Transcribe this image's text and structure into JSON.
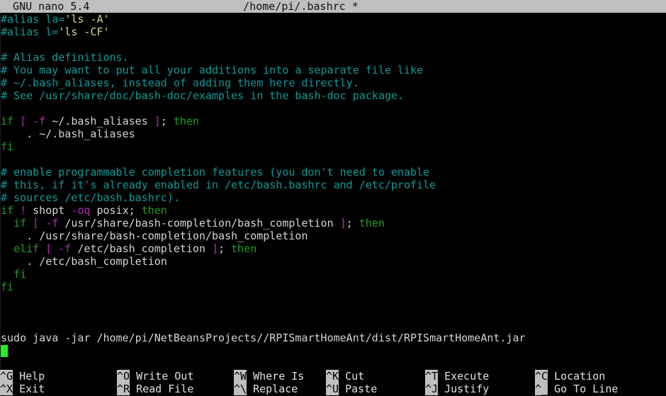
{
  "titlebar": {
    "app_name": "GNU nano 5.4",
    "filename": "/home/pi/.bashrc *",
    "bg_color": "#bfbfbf",
    "fg_color": "#101010"
  },
  "editor": {
    "background_color": "#000000",
    "colors": {
      "comment": "#0f9a9a",
      "string": "#d7d77a",
      "keyword": "#19a319",
      "operator": "#b429b4",
      "plain": "#d4d4d4",
      "cursor": "#22ee22"
    },
    "lines": [
      {
        "i": 0,
        "text": "#alias la='ls -A'"
      },
      {
        "i": 1,
        "text": "#alias l='ls -CF'"
      },
      {
        "i": 2,
        "text": ""
      },
      {
        "i": 3,
        "text": "# Alias definitions."
      },
      {
        "i": 4,
        "text": "# You may want to put all your additions into a separate file like"
      },
      {
        "i": 5,
        "text": "# ~/.bash_aliases, instead of adding them here directly."
      },
      {
        "i": 6,
        "text": "# See /usr/share/doc/bash-doc/examples in the bash-doc package."
      },
      {
        "i": 7,
        "text": ""
      },
      {
        "i": 8,
        "text": "if [ -f ~/.bash_aliases ]; then"
      },
      {
        "i": 9,
        "text": "    . ~/.bash_aliases"
      },
      {
        "i": 10,
        "text": "fi"
      },
      {
        "i": 11,
        "text": ""
      },
      {
        "i": 12,
        "text": "# enable programmable completion features (you don't need to enable"
      },
      {
        "i": 13,
        "text": "# this, if it's already enabled in /etc/bash.bashrc and /etc/profile"
      },
      {
        "i": 14,
        "text": "# sources /etc/bash.bashrc)."
      },
      {
        "i": 15,
        "text": "if ! shopt -oq posix; then"
      },
      {
        "i": 16,
        "text": "  if [ -f /usr/share/bash-completion/bash_completion ]; then"
      },
      {
        "i": 17,
        "text": "    . /usr/share/bash-completion/bash_completion"
      },
      {
        "i": 18,
        "text": "  elif [ -f /etc/bash_completion ]; then"
      },
      {
        "i": 19,
        "text": "    . /etc/bash_completion"
      },
      {
        "i": 20,
        "text": "  fi"
      },
      {
        "i": 21,
        "text": "fi"
      },
      {
        "i": 22,
        "text": ""
      },
      {
        "i": 23,
        "text": ""
      },
      {
        "i": 24,
        "text": ""
      },
      {
        "i": 25,
        "text": "sudo java -jar /home/pi/NetBeansProjects//RPISmartHomeAnt/dist/RPISmartHomeAnt.jar"
      },
      {
        "i": 26,
        "text": ""
      }
    ],
    "cursor": {
      "line": 26,
      "column": 0
    }
  },
  "shortcuts": {
    "row1": [
      {
        "key": "^G",
        "label": "Help"
      },
      {
        "key": "^O",
        "label": "Write Out"
      },
      {
        "key": "^W",
        "label": "Where Is"
      },
      {
        "key": "^K",
        "label": "Cut"
      },
      {
        "key": "^T",
        "label": "Execute"
      },
      {
        "key": "^C",
        "label": "Location"
      }
    ],
    "row2": [
      {
        "key": "^X",
        "label": "Exit"
      },
      {
        "key": "^R",
        "label": "Read File"
      },
      {
        "key": "^\\",
        "label": "Replace"
      },
      {
        "key": "^U",
        "label": "Paste"
      },
      {
        "key": "^J",
        "label": "Justify"
      },
      {
        "key": "^_",
        "label": "Go To Line"
      }
    ]
  }
}
